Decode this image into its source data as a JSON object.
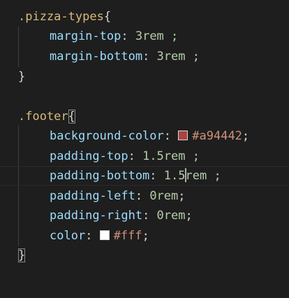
{
  "editor": {
    "lines": {
      "l1": {
        "selector": ".pizza-types",
        "brace": "{"
      },
      "l2": {
        "property": "margin-top",
        "colon": ":",
        "value": " 3rem ;"
      },
      "l3": {
        "property": "margin-bottom",
        "colon": ":",
        "value": " 3rem ;"
      },
      "l4": {
        "brace": "}"
      },
      "l6": {
        "selector": ".footer",
        "brace": "{"
      },
      "l7": {
        "property": "background-color",
        "colon": ":",
        "value": "#a94442",
        "semicolon": ";",
        "swatch_color": "#a94442"
      },
      "l8": {
        "property": "padding-top",
        "colon": ":",
        "value": " 1.5rem ;"
      },
      "l9": {
        "property": "padding-bottom",
        "colon": ":",
        "value_before_cursor": " 1.5",
        "value_after_cursor": "rem ;"
      },
      "l10": {
        "property": "padding-left",
        "colon": ":",
        "value": " 0rem",
        "semicolon": ";"
      },
      "l11": {
        "property": "padding-right",
        "colon": ":",
        "value": " 0rem",
        "semicolon": ";"
      },
      "l12": {
        "property": "color",
        "colon": ":",
        "value": "#fff",
        "semicolon": ";",
        "swatch_color": "#ffffff"
      },
      "l13": {
        "brace": "}"
      }
    }
  }
}
